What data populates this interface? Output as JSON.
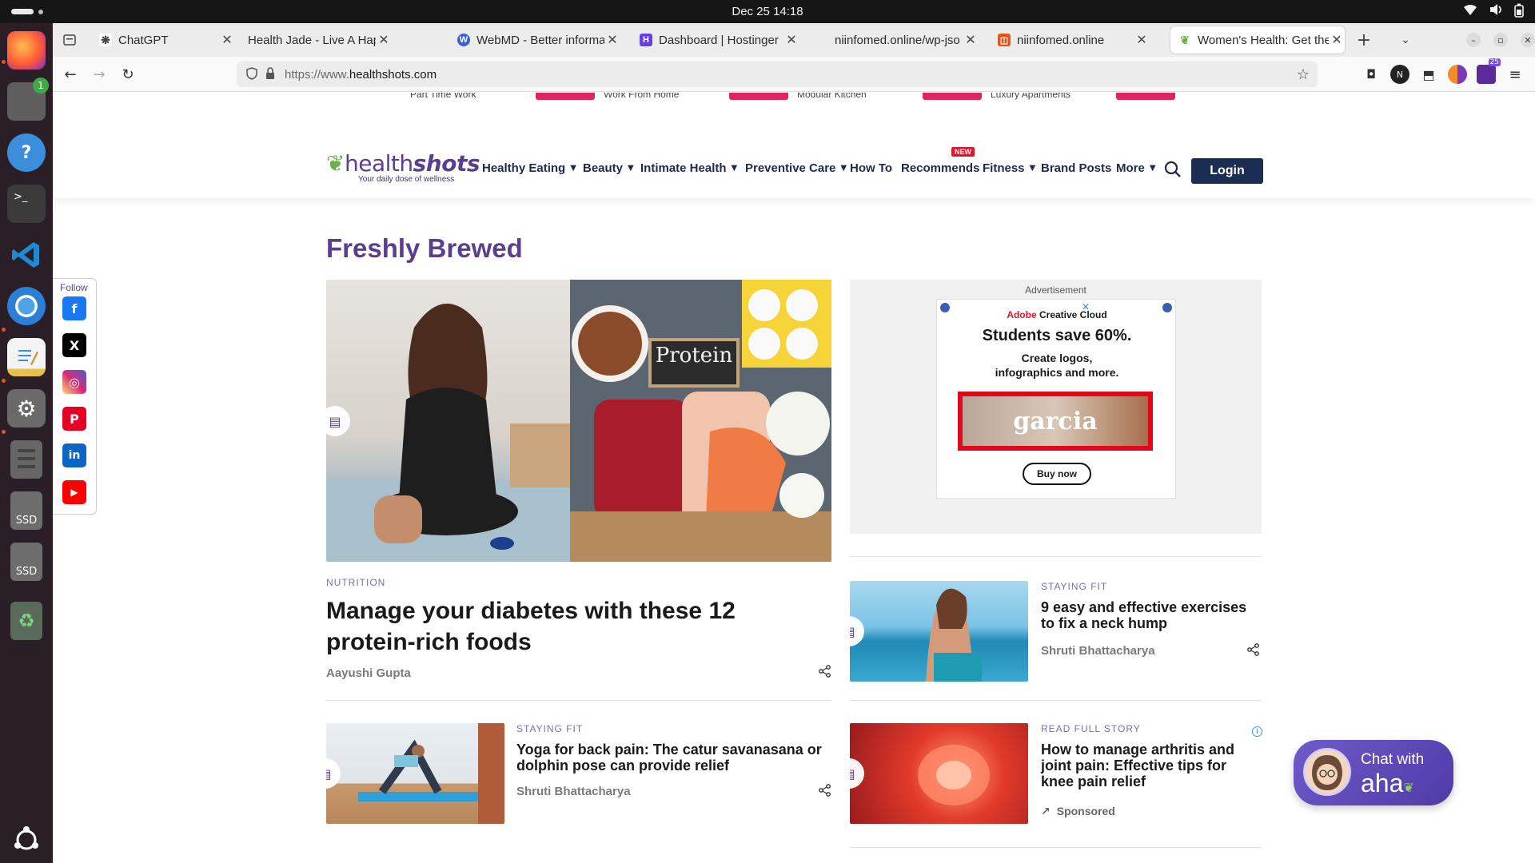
{
  "system": {
    "clock": "Dec 25  14:18"
  },
  "dock": {
    "items": [
      {
        "name": "Firefox",
        "icon": "firefox-icon"
      },
      {
        "name": "Files",
        "icon": "files-icon",
        "badge": "1"
      },
      {
        "name": "Help",
        "icon": "help-icon"
      },
      {
        "name": "Terminal",
        "icon": "terminal-icon",
        "glyph": ">_"
      },
      {
        "name": "VS Code",
        "icon": "vscode-icon"
      },
      {
        "name": "Chromium",
        "icon": "chromium-icon"
      },
      {
        "name": "Text Editor",
        "icon": "text-editor-icon"
      },
      {
        "name": "Settings",
        "icon": "settings-icon"
      },
      {
        "name": "Server",
        "icon": "server-icon"
      },
      {
        "name": "SSD",
        "icon": "drive-icon",
        "label": "SSD"
      },
      {
        "name": "SSD",
        "icon": "drive-icon",
        "label": "SSD"
      },
      {
        "name": "Trash",
        "icon": "trash-icon"
      }
    ]
  },
  "browser": {
    "tabs": [
      {
        "title": "ChatGPT",
        "favicon": "chatgpt-icon",
        "color": "#444444"
      },
      {
        "title": "Health Jade - Live A Happier",
        "favicon": "none",
        "color": "#ffffff"
      },
      {
        "title": "WebMD - Better informa",
        "favicon": "webmd-icon",
        "color": "#3b5fd6"
      },
      {
        "title": "Dashboard | Hostinger",
        "favicon": "hostinger-icon",
        "color": "#673de6"
      },
      {
        "title": "niinfomed.online/wp-jso",
        "favicon": "none",
        "color": "#ffffff"
      },
      {
        "title": "niinfomed.online",
        "favicon": "site-icon",
        "color": "#e2551e"
      },
      {
        "title": "Women's Health: Get the",
        "favicon": "healthshots-icon",
        "color": "#6ab04c",
        "active": true
      }
    ],
    "url_host": "https://www.",
    "url_domain": "healthshots.com",
    "ext_badge": "25"
  },
  "site": {
    "ad_strip": [
      "Part Time Work",
      "Work From Home",
      "Modular Kitchen",
      "Luxury Apartments"
    ],
    "logo": {
      "light": "health",
      "bold": "shots",
      "tagline": "Your daily dose of wellness"
    },
    "menu": [
      {
        "label": "Healthy Eating",
        "chevron": true
      },
      {
        "label": "Beauty",
        "chevron": true
      },
      {
        "label": "Intimate Health",
        "chevron": true
      },
      {
        "label": "Preventive Care",
        "chevron": true
      },
      {
        "label": "How To",
        "chevron": false
      },
      {
        "label": "Recommends",
        "chevron": false
      },
      {
        "label": "Fitness",
        "chevron": true
      },
      {
        "label": "Brand Posts",
        "chevron": false
      },
      {
        "label": "More",
        "chevron": true
      }
    ],
    "new_badge": "NEW",
    "login": "Login",
    "follow_label": "Follow",
    "social": [
      {
        "name": "facebook",
        "glyph": "f",
        "color": "#1877f2"
      },
      {
        "name": "x",
        "glyph": "X",
        "color": "#000000"
      },
      {
        "name": "instagram",
        "glyph": "◎",
        "color": "#d62976"
      },
      {
        "name": "pinterest",
        "glyph": "P",
        "color": "#e60023"
      },
      {
        "name": "linkedin",
        "glyph": "in",
        "color": "#0a66c2"
      },
      {
        "name": "youtube",
        "glyph": "▶",
        "color": "#ff0000"
      }
    ],
    "section_title": "Freshly Brewed",
    "hero": {
      "category": "NUTRITION",
      "title_line1": "Manage your diabetes with these 12",
      "title_line2": "protein-rich foods",
      "author": "Aayushi Gupta",
      "image_text": "Protein"
    },
    "ad": {
      "label": "Advertisement",
      "brand_red": "Adobe",
      "brand_black": " Creative Cloud",
      "headline": "Students save 60%.",
      "sub_line1": "Create logos,",
      "sub_line2": "infographics and more.",
      "creative_text": "garcia",
      "cta": "Buy now"
    },
    "articles": [
      {
        "category": "STAYING FIT",
        "title_line1": "9 easy and effective exercises",
        "title_line2": "to fix a neck hump",
        "author": "Shruti Bhattacharya"
      },
      {
        "category": "STAYING FIT",
        "title_line1": "Yoga for back pain: The catur savanasana or",
        "title_line2": "dolphin pose can provide relief",
        "author": "Shruti Bhattacharya"
      },
      {
        "category": "READ FULL STORY",
        "title_line1": "How to manage arthritis and",
        "title_line2": "joint pain: Effective tips for",
        "title_line3": "knee pain relief",
        "sponsored": "Sponsored"
      }
    ],
    "chat": {
      "line1": "Chat with",
      "line2": "aha"
    }
  }
}
